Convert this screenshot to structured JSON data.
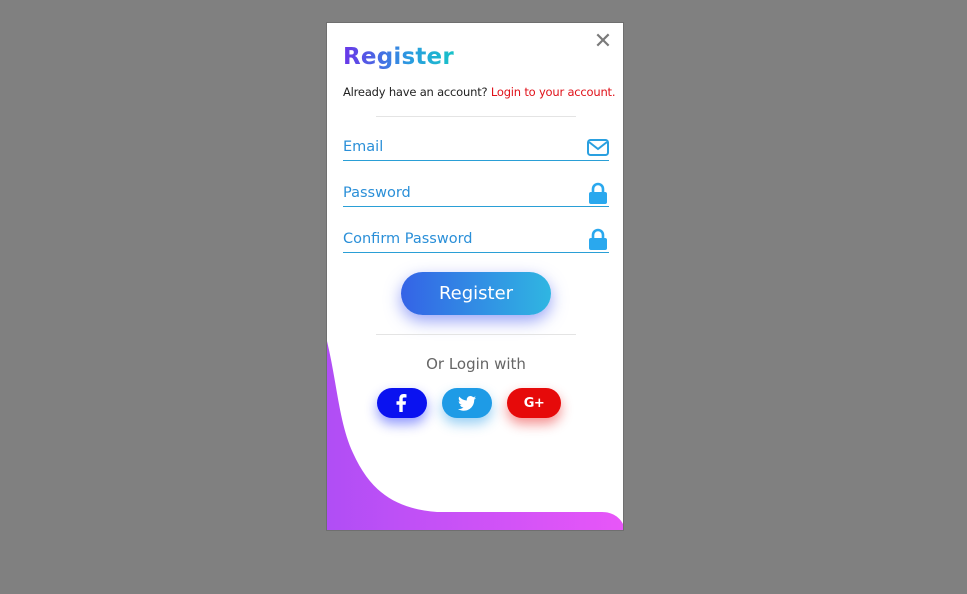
{
  "modal": {
    "title": "Register",
    "subtitle_text": "Already have an account? ",
    "login_link": "Login to your account.",
    "close_icon": "close-icon"
  },
  "form": {
    "email_placeholder": "Email",
    "password_placeholder": "Password",
    "confirm_placeholder": "Confirm Password",
    "email_icon": "envelope-icon",
    "lock_icon": "lock-icon",
    "submit_label": "Register"
  },
  "social": {
    "heading": "Or Login with",
    "google_label": "G+",
    "buttons": [
      "facebook",
      "twitter",
      "google-plus"
    ]
  },
  "colors": {
    "overlay": "#808080",
    "accent_blue": "#2a8fd8",
    "link_red": "#e0121a",
    "facebook": "#0a12f0",
    "twitter": "#1e9be6",
    "google": "#e60a0a",
    "wave_purple": "#b04ef5",
    "wave_pink": "#e856f8"
  }
}
